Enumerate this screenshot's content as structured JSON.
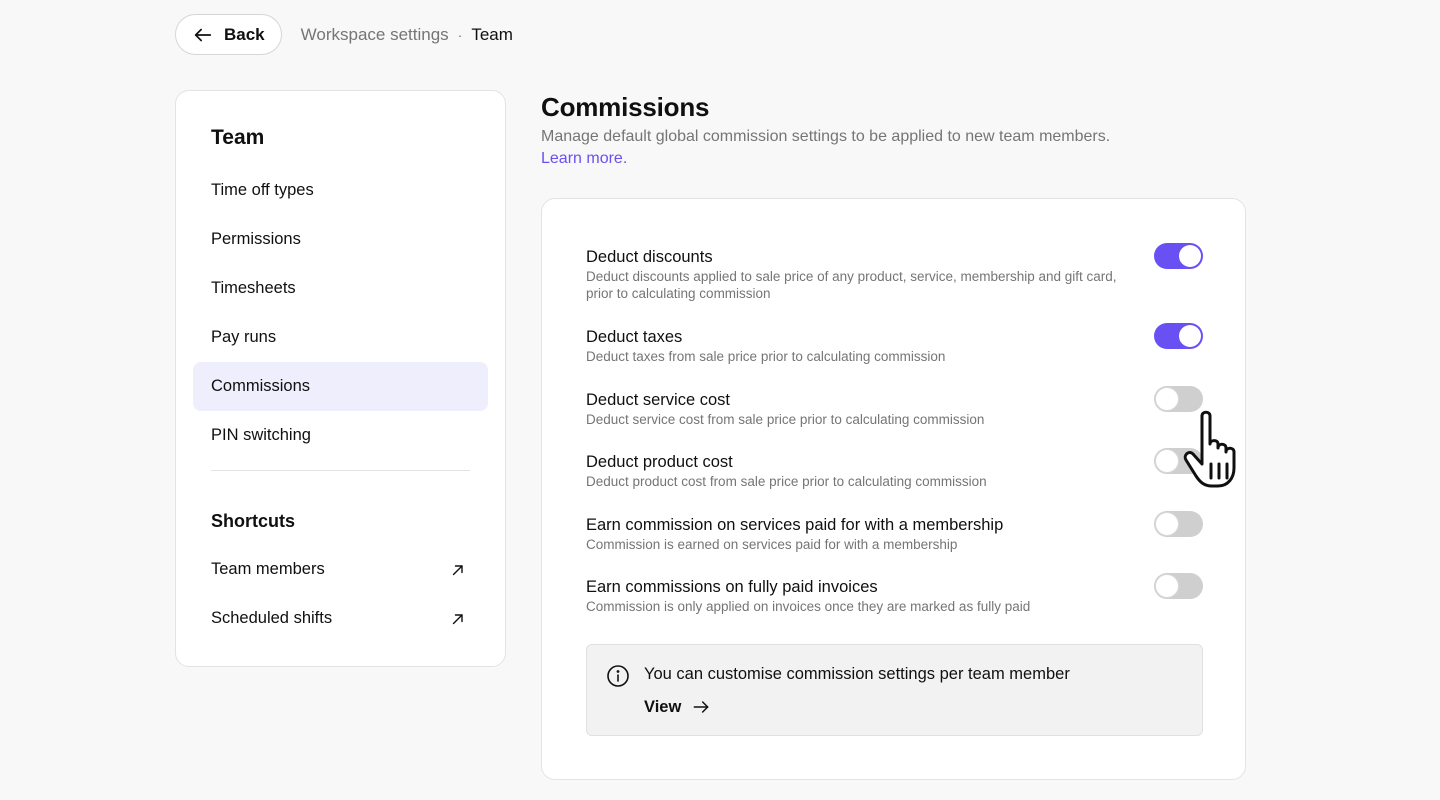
{
  "topbar": {
    "back_label": "Back",
    "breadcrumb_parent": "Workspace settings",
    "breadcrumb_separator": "·",
    "breadcrumb_current": "Team"
  },
  "sidebar": {
    "title": "Team",
    "items": [
      {
        "label": "Time off types",
        "active": false
      },
      {
        "label": "Permissions",
        "active": false
      },
      {
        "label": "Timesheets",
        "active": false
      },
      {
        "label": "Pay runs",
        "active": false
      },
      {
        "label": "Commissions",
        "active": true
      },
      {
        "label": "PIN switching",
        "active": false
      }
    ],
    "shortcuts_title": "Shortcuts",
    "shortcuts": [
      {
        "label": "Team members",
        "icon": "external-arrow-icon"
      },
      {
        "label": "Scheduled shifts",
        "icon": "external-arrow-icon"
      }
    ]
  },
  "main": {
    "title": "Commissions",
    "description": "Manage default global commission settings to be applied to new team members.",
    "learn_more": "Learn more.",
    "settings": [
      {
        "title": "Deduct discounts",
        "description": "Deduct discounts applied to sale price of any product, service, membership and gift card, prior to calculating commission",
        "enabled": true
      },
      {
        "title": "Deduct taxes",
        "description": "Deduct taxes from sale price prior to calculating commission",
        "enabled": true
      },
      {
        "title": "Deduct service cost",
        "description": "Deduct service cost from sale price prior to calculating commission",
        "enabled": false
      },
      {
        "title": "Deduct product cost",
        "description": "Deduct product cost from sale price prior to calculating commission",
        "enabled": false
      },
      {
        "title": "Earn commission on services paid for with a membership",
        "description": "Commission is earned on services paid for with a membership",
        "enabled": false
      },
      {
        "title": "Earn commissions on fully paid invoices",
        "description": "Commission is only applied on invoices once they are marked as fully paid",
        "enabled": false
      }
    ],
    "info": {
      "text": "You can customise commission settings per team member",
      "link_label": "View"
    }
  },
  "colors": {
    "accent": "#6950f3",
    "active_nav_bg": "#eeeefc",
    "toggle_off": "#cfcfcf",
    "muted_text": "#757575"
  }
}
